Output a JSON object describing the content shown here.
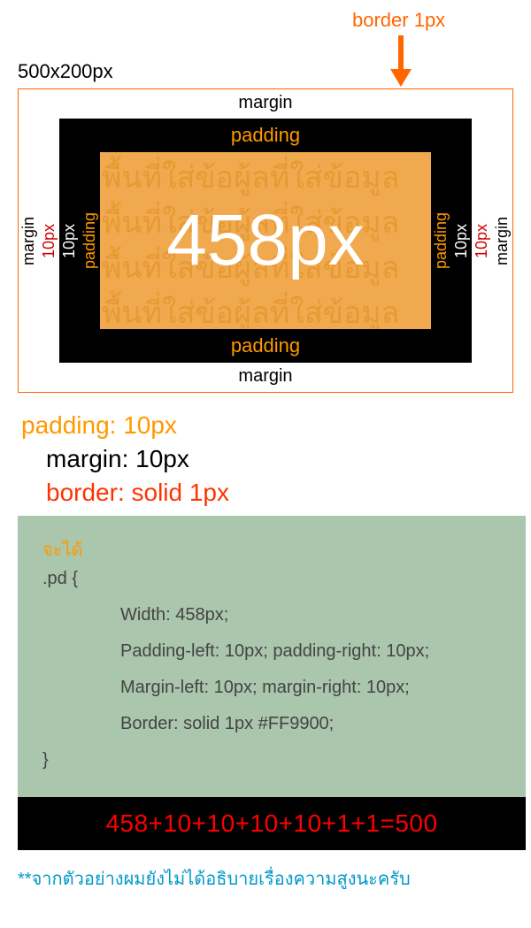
{
  "header": {
    "border_label": "border 1px",
    "dimension_label": "500x200px"
  },
  "diagram": {
    "margin_label": "margin",
    "padding_label": "padding",
    "ten_label": "10px",
    "content_watermark": "พื้นที่ใส่ข้อผู้ลที่ใส่ข้อมูล\nพื้นที่ใส่ข้อผู้ลที่ใส่ข้อมูล\nพื้นที่ใส่ข้อผู้ลที่ใส่ข้อมูล\nพื้นที่ใส่ข้อผู้ลที่ใส่ข้อมูล",
    "content_value": "458px"
  },
  "properties": {
    "padding": "padding: 10px",
    "margin": "margin: 10px",
    "border": "border: solid 1px"
  },
  "code": {
    "lead": "จะได้",
    "selector": ".pd {",
    "lines": [
      "Width: 458px;",
      "Padding-left: 10px; padding-right: 10px;",
      "Margin-left: 10px; margin-right: 10px;",
      "Border: solid 1px #FF9900;"
    ],
    "close": "}"
  },
  "calc": "458+10+10+10+10+1+1=500",
  "footnote": "**จากตัวอย่างผมยังไม่ได้อธิบายเรื่องความสูงนะครับ"
}
